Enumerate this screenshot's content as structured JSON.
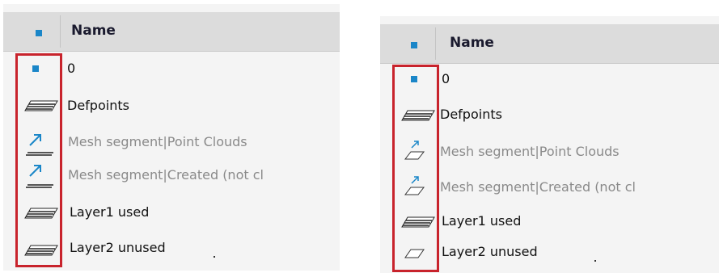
{
  "left_panel": {
    "header": {
      "icon": "blue-square-icon",
      "name_label": "Name"
    },
    "rows": [
      {
        "label": "0",
        "icon": "blue-square-icon",
        "style": "dark"
      },
      {
        "label": "Defpoints",
        "icon": "layer-plane-filled-icon",
        "style": "dark"
      },
      {
        "label": "Mesh segment|Point Clouds",
        "icon": "blue-arrow-icon",
        "style": "gray"
      },
      {
        "label": "Mesh segment|Created (not cl",
        "icon": "blue-arrow-icon",
        "style": "gray"
      },
      {
        "label": "Layer1 used",
        "icon": "layer-plane-filled-icon",
        "style": "dark"
      },
      {
        "label": "Layer2 unused",
        "icon": "layer-plane-filled-icon",
        "style": "dark"
      }
    ]
  },
  "right_panel": {
    "header": {
      "icon": "blue-square-icon",
      "name_label": "Name"
    },
    "rows": [
      {
        "label": "0",
        "icon": "blue-square-icon",
        "style": "dark"
      },
      {
        "label": "Defpoints",
        "icon": "layer-plane-filled-icon",
        "style": "dark"
      },
      {
        "label": "Mesh segment|Point Clouds",
        "icon": "layer-plane-outline-arrow-icon",
        "style": "gray"
      },
      {
        "label": "Mesh segment|Created (not cl",
        "icon": "layer-plane-outline-arrow-icon",
        "style": "gray"
      },
      {
        "label": "Layer1 used",
        "icon": "layer-plane-filled-icon",
        "style": "dark"
      },
      {
        "label": "Layer2 unused",
        "icon": "layer-plane-outline-icon",
        "style": "dark"
      }
    ]
  },
  "colors": {
    "highlight_box": "#c8232c",
    "layer_bullet": "#1a86c8",
    "muted_text": "#8a8a8a"
  }
}
